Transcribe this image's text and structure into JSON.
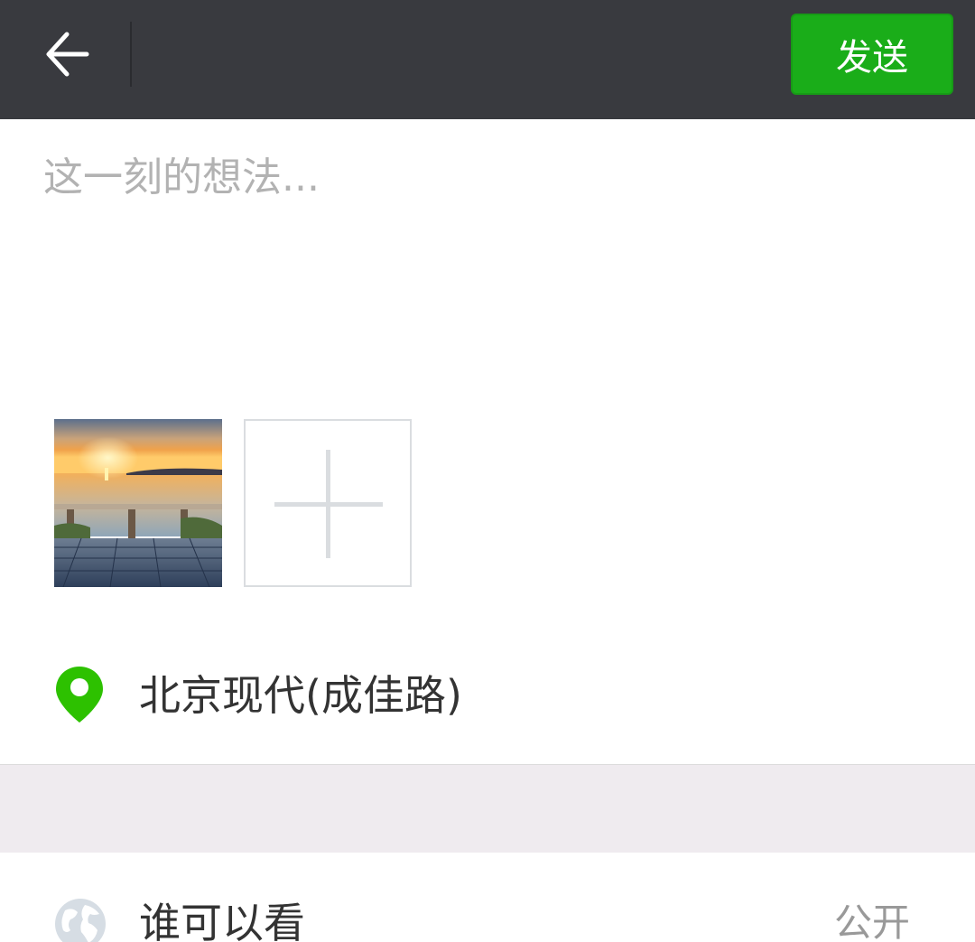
{
  "header": {
    "back_icon": "arrow-left-icon",
    "send_label": "发送",
    "colors": {
      "bar": "#393a3f",
      "send": "#1aad19"
    }
  },
  "compose": {
    "placeholder": "这一刻的想法...",
    "value": ""
  },
  "photos": {
    "add_icon": "plus-icon"
  },
  "location": {
    "icon": "location-pin-icon",
    "label": "北京现代(成佳路)",
    "icon_color": "#2dc100"
  },
  "privacy": {
    "icon": "globe-icon",
    "label": "谁可以看",
    "value": "公开"
  }
}
